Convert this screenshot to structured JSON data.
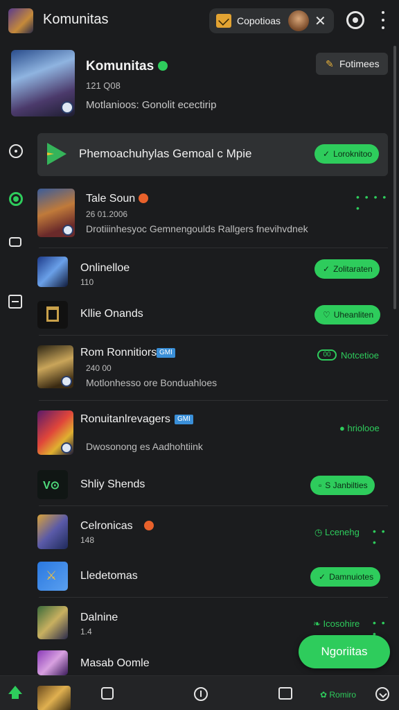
{
  "header": {
    "title": "Komunitas",
    "pill_label": "Copotioas"
  },
  "profile": {
    "name": "Komunitas",
    "count": "121 Q08",
    "description": "Motlanioos: Gonolit ecectirip",
    "action_label": "Fotimees"
  },
  "highlight": {
    "title": "Phemoachuhylas Gemoal c Mpie",
    "button_label": "Loroknitoo"
  },
  "items": [
    {
      "title": "Tale Soun",
      "meta": "26 01.2006",
      "desc": "Drotiiinhesyoc Gemnengoulds Rallgers fnevihvdnek"
    },
    {
      "title": "Onlinelloe",
      "meta": "110",
      "button_label": "Zolitaraten"
    },
    {
      "title": "Kllie Onands",
      "button_label": "Uheanliten"
    },
    {
      "title": "Rom Ronnitiors",
      "tag": "GMI",
      "meta": "240 00",
      "desc": "Motlonhesso ore Bonduahloes",
      "action_label": "Notcetioe"
    },
    {
      "title": "Ronuitanlrevagers",
      "tag": "GMI",
      "desc": "Dwosonong es Aadhohtiink",
      "link_label": "hriolooe"
    },
    {
      "title": "Shliy Shends",
      "button_label": "S Janbilties"
    },
    {
      "title": "Celronicas",
      "meta": "148",
      "link_label": "Lcenehg"
    },
    {
      "title": "Lledetomas",
      "button_label": "Damnuiotes"
    },
    {
      "title": "Dalnine",
      "meta": "1.4",
      "link_label": "Icosohire"
    },
    {
      "title": "Masab Oomle"
    }
  ],
  "fab": {
    "label": "Ngoriitas"
  },
  "bottom": {
    "green_label": "Romiro"
  },
  "colors": {
    "accent": "#2ecc5c",
    "background": "#1b1c1e",
    "surface": "#2f3133"
  }
}
